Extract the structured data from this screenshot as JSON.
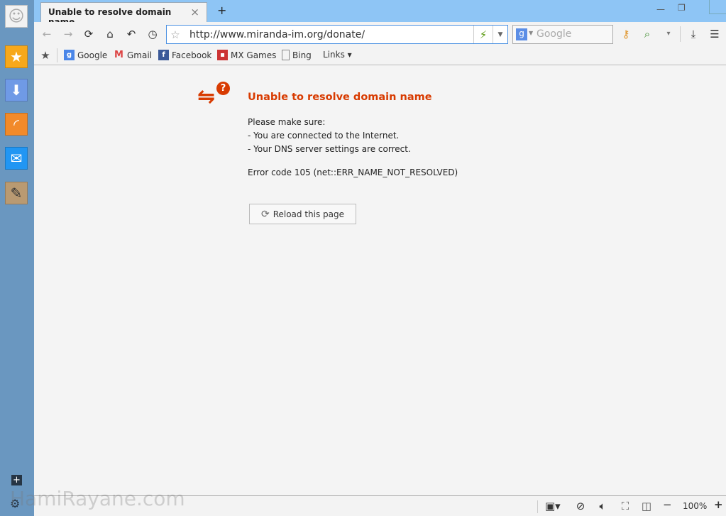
{
  "tab": {
    "title": "Unable to resolve domain name",
    "close": "×",
    "new_tab": "+"
  },
  "window": {
    "minimize": "—",
    "restore": "❐",
    "close": "✕"
  },
  "address": {
    "url": "http://www.miranda-im.org/donate/"
  },
  "search": {
    "placeholder": "Google",
    "engine": "g"
  },
  "bookmarks": [
    {
      "label": "Google"
    },
    {
      "label": "Gmail"
    },
    {
      "label": "Facebook"
    },
    {
      "label": "MX Games"
    },
    {
      "label": "Bing"
    },
    {
      "label": "Links ▾"
    }
  ],
  "error": {
    "title": "Unable to resolve domain name",
    "intro": "Please make sure:",
    "items": [
      "- You are connected to the Internet.",
      "- Your DNS server settings are correct."
    ],
    "code": "Error code 105 (net::ERR_NAME_NOT_RESOLVED)",
    "reload": "Reload this page",
    "color": "#d83b01"
  },
  "status": {
    "zoom": "100%",
    "minus": "−",
    "plus": "+"
  },
  "watermark": "HamiRayane.com",
  "colors": {
    "sidebar": "#6a97c0",
    "titlebar": "#8ec5f5"
  }
}
